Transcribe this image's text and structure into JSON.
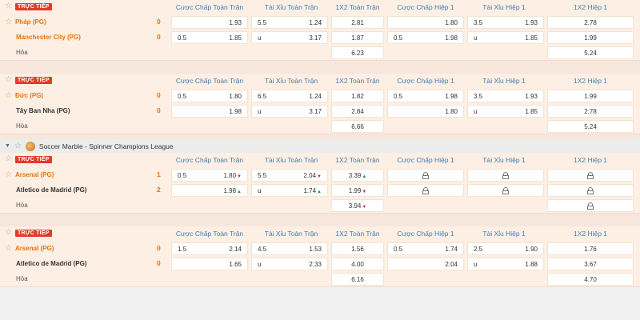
{
  "headers": [
    "Cược Chấp Toàn Trận",
    "Tài Xỉu Toàn Trận",
    "1X2 Toàn Trận",
    "Cược Chấp Hiệp 1",
    "Tài Xỉu Hiệp 1",
    "1X2 Hiệp 1"
  ],
  "live_label": "TRỰC TIẾP",
  "draw_label": "Hòa",
  "league_title": "Soccer Marble - Spinner Champions League",
  "matches": [
    {
      "home": {
        "name": "Pháp (PG)",
        "score": "0",
        "hdp_line": "",
        "hdp": "1.93",
        "ou_line": "5.5",
        "ou": "1.24",
        "x12": "2.81",
        "h1_hdp_line": "",
        "h1_hdp": "1.80",
        "h1_ou_line": "3.5",
        "h1_ou": "1.93",
        "h1_x12": "2.78"
      },
      "away": {
        "name": "Manchester City (PG)",
        "score": "0",
        "hdp_line": "0.5",
        "hdp": "1.85",
        "ou_line": "u",
        "ou": "3.17",
        "x12": "1.87",
        "h1_hdp_line": "0.5",
        "h1_hdp": "1.98",
        "h1_ou_line": "u",
        "h1_ou": "1.85",
        "h1_x12": "1.99"
      },
      "draw": {
        "x12": "6.23",
        "h1_x12": "5.24"
      }
    },
    {
      "home": {
        "name": "Đức (PG)",
        "score": "0",
        "hdp_line": "0.5",
        "hdp": "1.80",
        "ou_line": "6.5",
        "ou": "1.24",
        "x12": "1.82",
        "h1_hdp_line": "0.5",
        "h1_hdp": "1.98",
        "h1_ou_line": "3.5",
        "h1_ou": "1.93",
        "h1_x12": "1.99"
      },
      "away": {
        "name": "Tây Ban Nha (PG)",
        "score": "0",
        "hdp_line": "",
        "hdp": "1.98",
        "ou_line": "u",
        "ou": "3.17",
        "x12": "2.84",
        "h1_hdp_line": "",
        "h1_hdp": "1.80",
        "h1_ou_line": "u",
        "h1_ou": "1.85",
        "h1_x12": "2.78"
      },
      "draw": {
        "x12": "6.66",
        "h1_x12": "5.24"
      }
    },
    {
      "home": {
        "name": "Arsenal (PG)",
        "score": "1",
        "hdp_line": "0.5",
        "hdp": "1.80",
        "hdp_trend": "▼",
        "ou_line": "5.5",
        "ou": "2.04",
        "ou_trend": "▼",
        "x12": "3.39",
        "x12_trend": "▲"
      },
      "away": {
        "name": "Atletico de Madrid (PG)",
        "score": "2",
        "hdp_line": "",
        "hdp": "1.98",
        "hdp_trend": "▲",
        "ou_line": "u",
        "ou": "1.74",
        "ou_trend": "▲",
        "x12": "1.99",
        "x12_trend": "▼"
      },
      "draw": {
        "x12": "3.94",
        "x12_trend": "▼"
      },
      "locked_first_half": true
    },
    {
      "home": {
        "name": "Arsenal (PG)",
        "score": "0",
        "hdp_line": "1.5",
        "hdp": "2.14",
        "ou_line": "4.5",
        "ou": "1.53",
        "x12": "1.56",
        "h1_hdp_line": "0.5",
        "h1_hdp": "1.74",
        "h1_ou_line": "2.5",
        "h1_ou": "1.90",
        "h1_x12": "1.76"
      },
      "away": {
        "name": "Atletico de Madrid (PG)",
        "score": "0",
        "hdp_line": "",
        "hdp": "1.65",
        "ou_line": "u",
        "ou": "2.33",
        "x12": "4.00",
        "h1_hdp_line": "",
        "h1_hdp": "2.04",
        "h1_ou_line": "u",
        "h1_ou": "1.88",
        "h1_x12": "3.67"
      },
      "draw": {
        "x12": "6.16",
        "h1_x12": "4.70"
      }
    }
  ],
  "colors": {
    "accent_orange": "#e8740f",
    "live_red": "#e53a28",
    "header_blue": "#3f7fb8",
    "row_bg": "#fdefe3"
  }
}
